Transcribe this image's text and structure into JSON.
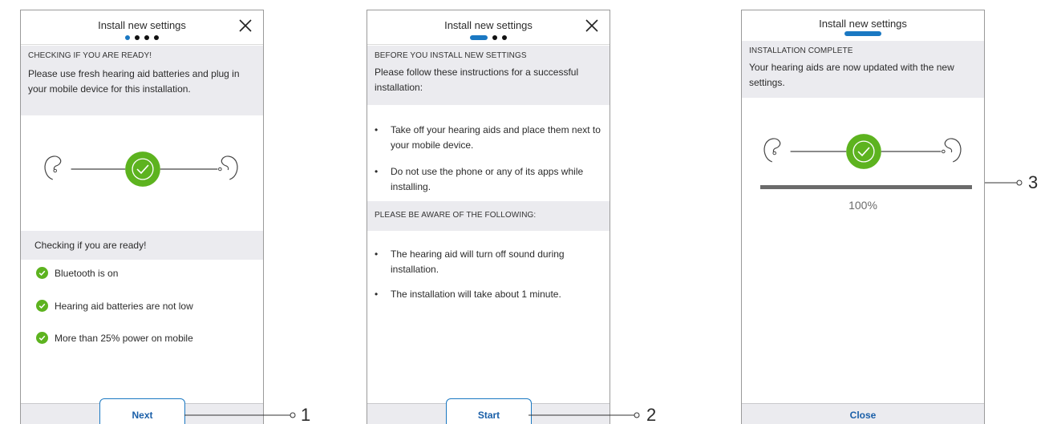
{
  "screen1": {
    "title": "Install new settings",
    "section_heading": "CHECKING IF YOU ARE READY!",
    "intro": "Please use fresh hearing aid batteries and plug in your mobile device for this installation.",
    "checklist_heading": "Checking if you are ready!",
    "checks": [
      "Bluetooth is on",
      "Hearing aid batteries are not low",
      "More than 25% power on mobile"
    ],
    "button_label": "Next",
    "step": "1 of 4"
  },
  "screen2": {
    "title": "Install new settings",
    "section_heading": "BEFORE YOU INSTALL NEW SETTINGS",
    "intro": "Please follow these instructions for a successful installation:",
    "instructions": [
      "Take off your hearing aids and place them next to your mobile device.",
      "Do not use the phone or any of its apps while installing."
    ],
    "aware_heading": "PLEASE BE AWARE OF THE FOLLOWING:",
    "notes": [
      "The hearing aid will turn off sound during installation.",
      "The installation will take about 1 minute."
    ],
    "button_label": "Start",
    "step": "2 of 4"
  },
  "screen3": {
    "title": "Install new settings",
    "section_heading": "INSTALLATION COMPLETE",
    "intro": "Your hearing aids are now updated with the new settings.",
    "progress_percent": 100,
    "progress_label": "100%",
    "close_label": "Close"
  },
  "callouts": [
    "1",
    "2",
    "3"
  ],
  "bullet_char": "•",
  "colors": {
    "accent_blue": "#1a78c2",
    "success_green": "#5db31f",
    "band_gray": "#ebebef",
    "progress_gray": "#6b6b6b"
  }
}
